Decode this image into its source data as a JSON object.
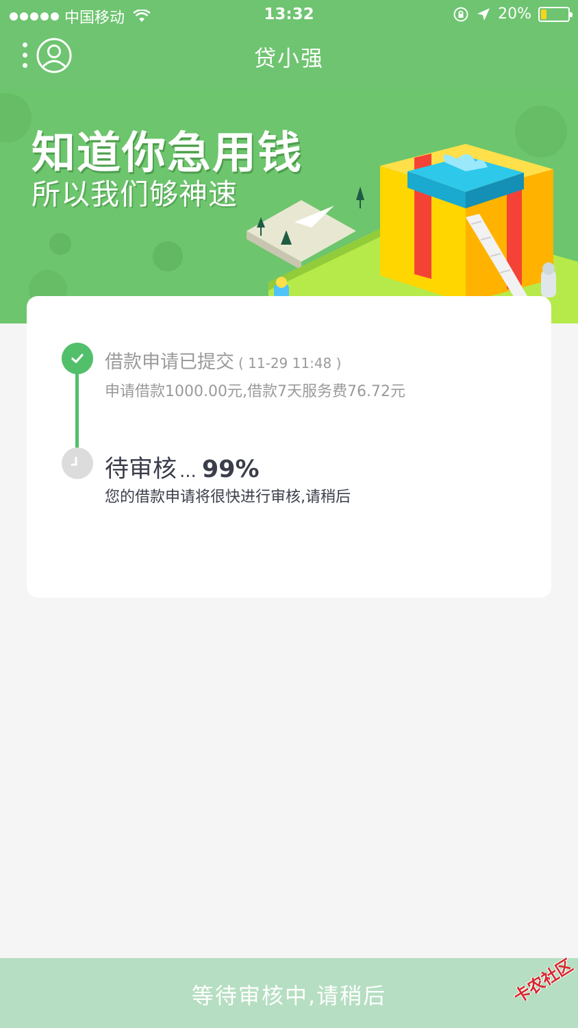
{
  "status_bar": {
    "carrier": "中国移动",
    "time": "13:32",
    "battery_percent": "20%",
    "battery_level": 0.2,
    "icons": [
      "signal-dots-icon",
      "wifi-icon",
      "rotation-lock-icon",
      "location-icon",
      "battery-icon"
    ]
  },
  "nav": {
    "title": "贷小强",
    "left_icons": [
      "more-vertical-icon",
      "user-profile-icon"
    ]
  },
  "banner": {
    "headline": "知道你急用钱",
    "subline": "所以我们够神速"
  },
  "progress": {
    "steps": [
      {
        "status": "done",
        "title": "借款申请已提交",
        "time": "( 11-29 11:48 )",
        "description": "申请借款1000.00元,借款7天服务费76.72元"
      },
      {
        "status": "pending",
        "title": "待审核",
        "ellipsis": "...",
        "percent": "99%",
        "description": "您的借款申请将很快进行审核,请稍后"
      }
    ]
  },
  "bottom_bar": {
    "label": "等待审核中,请稍后"
  },
  "watermark": "卡农社区",
  "colors": {
    "header_green": "#6ec470",
    "accent_green": "#52bf6b",
    "bottom_bar": "#b6dec2",
    "text_dark": "#3b3e4a",
    "text_gray": "#9a9a9a",
    "battery_yellow": "#f7d51d"
  }
}
